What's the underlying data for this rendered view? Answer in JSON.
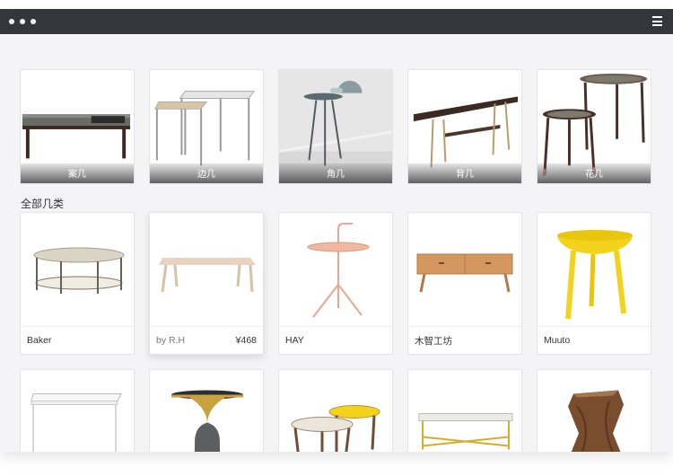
{
  "header": {
    "menu_icon": "hamburger-menu-icon"
  },
  "categories": [
    {
      "label": "案几"
    },
    {
      "label": "边几"
    },
    {
      "label": "角几"
    },
    {
      "label": "背几"
    },
    {
      "label": "花几"
    }
  ],
  "section": {
    "title": "全部几类"
  },
  "products_row1": [
    {
      "brand": "Baker",
      "by": "",
      "price": ""
    },
    {
      "brand": "",
      "by": "by R.H",
      "price": "¥468"
    },
    {
      "brand": "HAY",
      "by": "",
      "price": ""
    },
    {
      "brand": "木智工坊",
      "by": "",
      "price": ""
    },
    {
      "brand": "Muuto",
      "by": "",
      "price": ""
    }
  ],
  "colors": {
    "titlebar": "#35363c",
    "background": "#f4f4f6",
    "accent_yellow": "#f3d21c"
  }
}
